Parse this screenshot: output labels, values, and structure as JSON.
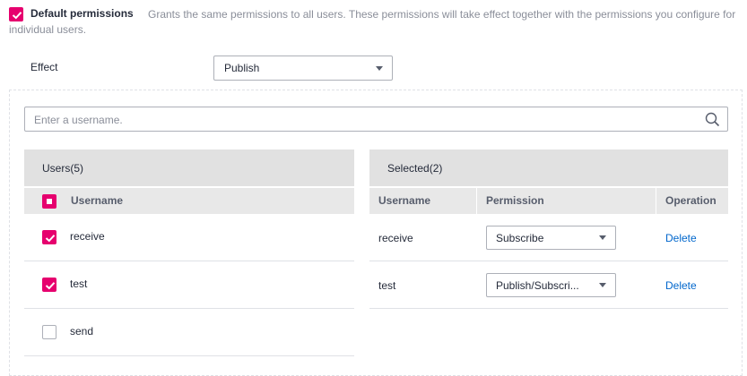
{
  "default_permissions": {
    "checked": true,
    "title": "Default permissions",
    "description": "Grants the same permissions to all users. These permissions will take effect together with the permissions you configure for individual users."
  },
  "effect": {
    "label": "Effect",
    "value": "Publish"
  },
  "search": {
    "placeholder": "Enter a username."
  },
  "users_panel": {
    "title": "Users(5)",
    "column_username": "Username",
    "rows": [
      {
        "name": "receive",
        "checked": true
      },
      {
        "name": "test",
        "checked": true
      },
      {
        "name": "send",
        "checked": false
      }
    ]
  },
  "selected_panel": {
    "title": "Selected(2)",
    "columns": {
      "username": "Username",
      "permission": "Permission",
      "operation": "Operation"
    },
    "rows": [
      {
        "name": "receive",
        "permission": "Subscribe",
        "action": "Delete"
      },
      {
        "name": "test",
        "permission": "Publish/Subscri...",
        "action": "Delete"
      }
    ]
  },
  "colors": {
    "accent": "#e6006e",
    "link": "#0066cc",
    "header_bg": "#e1e1e1"
  }
}
